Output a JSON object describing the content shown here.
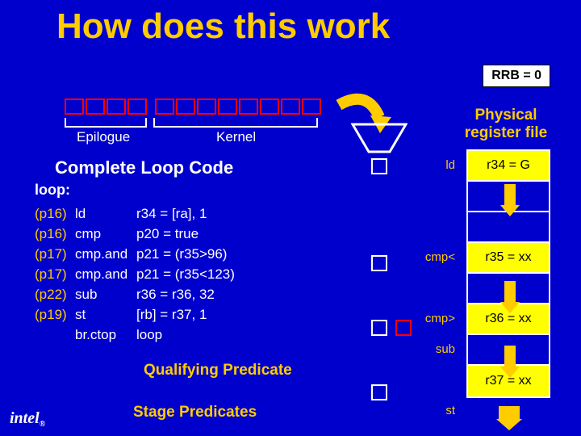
{
  "title": "How does this work",
  "rrb": "RRB = 0",
  "pipeline": {
    "epilogue_count": 4,
    "kernel_count": 8,
    "epilogue_label": "Epilogue",
    "kernel_label": "Kernel"
  },
  "section_heading": "Complete Loop Code",
  "loop_label": "loop:",
  "code": [
    {
      "pred": "(p16)",
      "op": "ld",
      "arg": "r34 = [ra], 1"
    },
    {
      "pred": "(p16)",
      "op": "cmp",
      "arg": "p20 = true"
    },
    {
      "pred": "(p17)",
      "op": "cmp.and",
      "arg": "p21 = (r35>96)"
    },
    {
      "pred": "(p17)",
      "op": "cmp.and",
      "arg": "p21 = (r35<123)"
    },
    {
      "pred": "(p22)",
      "op": "sub",
      "arg": "r36 = r36, 32"
    },
    {
      "pred": "(p19)",
      "op": "st",
      "arg": "[rb] = r37, 1"
    },
    {
      "pred": "",
      "op": "br.ctop",
      "arg": "loop"
    }
  ],
  "qualifying_predicate": "Qualifying Predicate",
  "stage_predicates": "Stage Predicates",
  "prf_title": "Physical register file",
  "ops": [
    "ld",
    "",
    "",
    "cmp<",
    "",
    "cmp>",
    "sub",
    "",
    "st"
  ],
  "prf_cells": [
    {
      "text": "r34 = G",
      "yellow": true
    },
    {
      "text": "",
      "yellow": false
    },
    {
      "text": "",
      "yellow": false
    },
    {
      "text": "r35 = xx",
      "yellow": true
    },
    {
      "text": "",
      "yellow": false
    },
    {
      "text": "r36 = xx",
      "yellow": true
    },
    {
      "text": "",
      "yellow": false
    },
    {
      "text": "r37 = xx",
      "yellow": true
    }
  ],
  "logo": "intel"
}
